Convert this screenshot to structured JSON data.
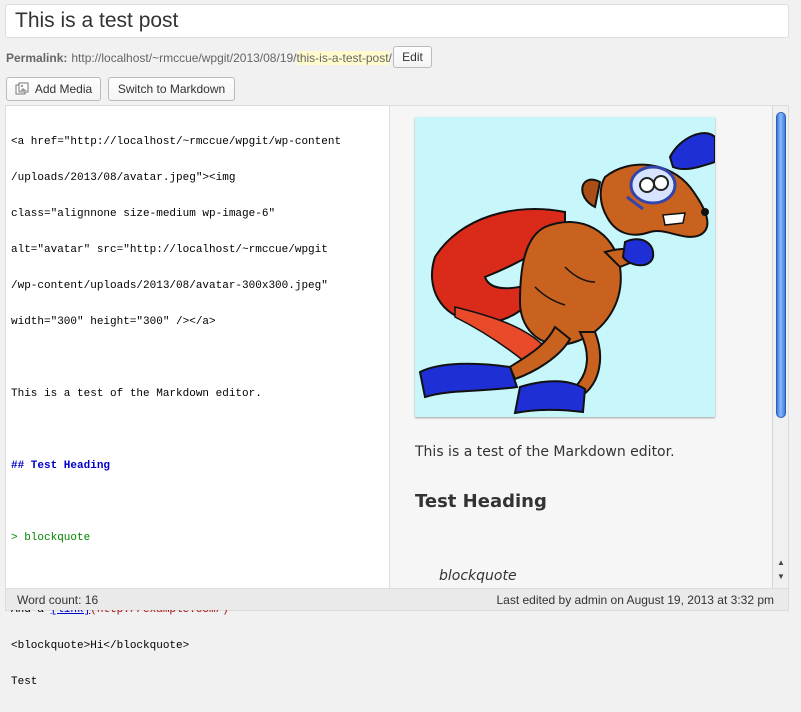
{
  "post": {
    "title": "This is a test post"
  },
  "permalink": {
    "label": "Permalink:",
    "base": "http://localhost/~rmccue/wpgit/2013/08/19/",
    "slug": "this-is-a-test-post",
    "trailing": "/",
    "edit_label": "Edit"
  },
  "toolbar": {
    "add_media_label": "Add Media",
    "switch_markdown_label": "Switch to Markdown"
  },
  "editor": {
    "source_lines": [
      "<a href=\"http://localhost/~rmccue/wpgit/wp-content",
      "/uploads/2013/08/avatar.jpeg\"><img",
      "class=\"alignnone size-medium wp-image-6\"",
      "alt=\"avatar\" src=\"http://localhost/~rmccue/wpgit",
      "/wp-content/uploads/2013/08/avatar-300x300.jpeg\"",
      "width=\"300\" height=\"300\" /></a>"
    ],
    "paragraph": "This is a test of the Markdown editor.",
    "heading": "## Test Heading",
    "quote": "> blockquote",
    "link_prefix": "And a ",
    "link_text": "[link]",
    "link_url": "(http://example.com/)",
    "html_line": "<blockquote>Hi</blockquote>",
    "last_line": "Test"
  },
  "preview": {
    "image_alt": "avatar",
    "paragraph": "This is a test of the Markdown editor.",
    "heading": "Test Heading",
    "quote": "blockquote"
  },
  "status": {
    "word_count": "Word count: 16",
    "last_edited": "Last edited by admin on August 19, 2013 at 3:32 pm"
  },
  "colors": {
    "image_background": "#c8f7fb",
    "permalink_slug_highlight": "#fffbcc",
    "scrollbar_thumb": "#3a7ae0"
  }
}
